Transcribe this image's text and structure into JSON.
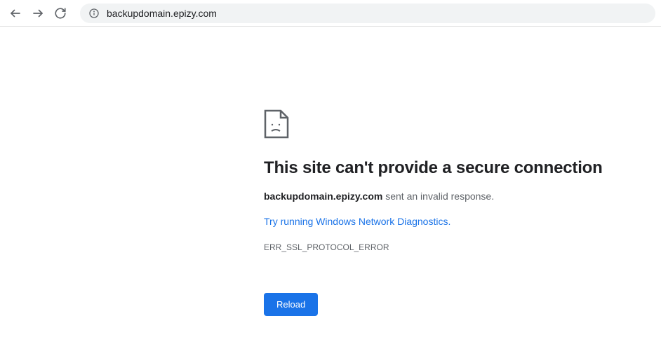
{
  "toolbar": {
    "url": "backupdomain.epizy.com"
  },
  "error": {
    "title": "This site can't provide a secure connection",
    "domain": "backupdomain.epizy.com",
    "message_suffix": " sent an invalid response.",
    "diagnostics_link": "Try running Windows Network Diagnostics.",
    "code": "ERR_SSL_PROTOCOL_ERROR",
    "reload_label": "Reload"
  }
}
